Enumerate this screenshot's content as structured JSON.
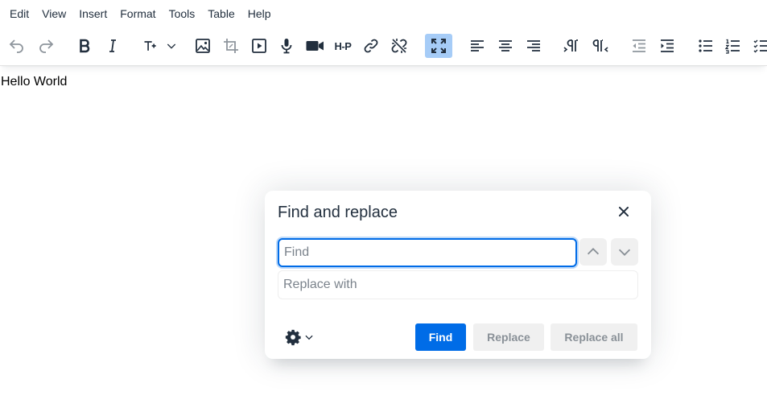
{
  "menubar": {
    "items": [
      "Edit",
      "View",
      "Insert",
      "Format",
      "Tools",
      "Table",
      "Help"
    ]
  },
  "toolbar": {
    "buttons": [
      {
        "icon": "undo-icon",
        "disabled": true
      },
      {
        "icon": "redo-icon",
        "disabled": true
      },
      {
        "icon": "bold-icon"
      },
      {
        "icon": "italic-icon"
      },
      {
        "icon": "font-size-icon"
      },
      {
        "icon": "image-icon"
      },
      {
        "icon": "crop-icon"
      },
      {
        "icon": "media-icon"
      },
      {
        "icon": "microphone-icon"
      },
      {
        "icon": "video-camera-icon"
      },
      {
        "icon": "h5p-icon"
      },
      {
        "icon": "link-icon"
      },
      {
        "icon": "unlink-icon"
      },
      {
        "icon": "fullscreen-icon",
        "active": true
      },
      {
        "icon": "align-left-icon"
      },
      {
        "icon": "align-center-icon"
      },
      {
        "icon": "align-right-icon"
      },
      {
        "icon": "ltr-icon"
      },
      {
        "icon": "rtl-icon"
      },
      {
        "icon": "outdent-icon"
      },
      {
        "icon": "indent-icon"
      },
      {
        "icon": "bullet-list-icon"
      },
      {
        "icon": "numbered-list-icon"
      },
      {
        "icon": "checklist-icon"
      }
    ],
    "h5p_label": "H-P"
  },
  "content": {
    "text": "Hello World"
  },
  "dialog": {
    "title": "Find and replace",
    "find_placeholder": "Find",
    "find_value": "",
    "replace_placeholder": "Replace with",
    "replace_value": "",
    "find_label": "Find",
    "replace_label": "Replace",
    "replace_all_label": "Replace all"
  },
  "colors": {
    "primary": "#006ce7",
    "text": "#222f3e",
    "button_secondary_bg": "#f0f0f0",
    "active_toolbar_bg": "#a6ccf7"
  }
}
